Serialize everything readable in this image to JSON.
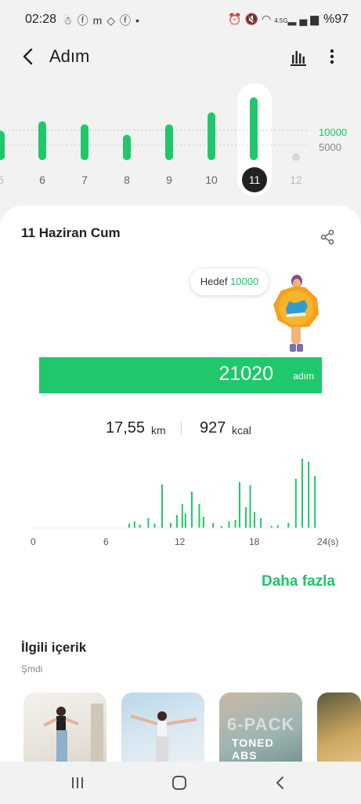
{
  "status_bar": {
    "time": "02:28",
    "left_icons": [
      "snapchat-icon",
      "facebook-icon",
      "m-icon",
      "tag-icon",
      "facebook-icon",
      "dot-icon"
    ],
    "right_icons": [
      "alarm-icon",
      "mute-icon",
      "wifi-icon",
      "4g-icon",
      "signal-icon"
    ],
    "network": "4.5G",
    "battery": "%97"
  },
  "header": {
    "title": "Adım",
    "chart_icon": "bar-chart-icon",
    "more_icon": "more-vert-icon",
    "back_icon": "back-chevron-icon"
  },
  "day_chart": {
    "goal_high": "10000",
    "goal_low": "5000",
    "labels": [
      "5",
      "6",
      "7",
      "8",
      "9",
      "10",
      "11",
      "12"
    ],
    "selected": "11",
    "accent": "#20c86b"
  },
  "chart_data": [
    {
      "type": "bar",
      "title": "",
      "categories": [
        "5",
        "6",
        "7",
        "8",
        "9",
        "10",
        "11",
        "12"
      ],
      "values": [
        9800,
        13000,
        12000,
        8500,
        12000,
        16000,
        21020,
        0
      ],
      "reference_lines": [
        10000,
        5000
      ],
      "xlabel": "",
      "ylabel": ""
    },
    {
      "type": "bar",
      "title": "",
      "x": [
        0,
        24
      ],
      "tick_labels": [
        "0",
        "6",
        "12",
        "18",
        "24(s)"
      ],
      "values": [
        0,
        0,
        0,
        0,
        0,
        0,
        0,
        0,
        0,
        0,
        0,
        0,
        0,
        0,
        0,
        0,
        0,
        0,
        0,
        0,
        0,
        0,
        0,
        0,
        0,
        0,
        0,
        0,
        0,
        0,
        0,
        0,
        0,
        0,
        0,
        0,
        0,
        0,
        0,
        0,
        0,
        0,
        0,
        0,
        0,
        0,
        0,
        0,
        0,
        0,
        0,
        0,
        0,
        0,
        0,
        0,
        0,
        0,
        0,
        0,
        0,
        0,
        0,
        0,
        0,
        0,
        0,
        0,
        0,
        0,
        0,
        0,
        0,
        0,
        0,
        0,
        0,
        0,
        0,
        0,
        0,
        0,
        0,
        0,
        0,
        0,
        0,
        0,
        0,
        0,
        0,
        0,
        0,
        0,
        0,
        0,
        0,
        0,
        0,
        0
      ],
      "xlabel": "",
      "ylabel": ""
    }
  ],
  "summary": {
    "date": "11 Haziran Cum",
    "share_icon": "share-icon",
    "goal_label": "Hedef",
    "goal_value": "10000",
    "steps": "21020",
    "steps_unit": "adım",
    "distance": "17,55",
    "distance_unit": "km",
    "calories": "927",
    "calories_unit": "kcal"
  },
  "hour_chart": {
    "ticks": [
      "0",
      "6",
      "12",
      "18",
      "24(s)"
    ]
  },
  "more_link": "Daha fazla",
  "related": {
    "title": "İlgili içerik",
    "subtitle": "Şmdi",
    "thumb3_big": "6-PACK",
    "thumb3_small": "TONED ABS"
  },
  "nav": {
    "recent_icon": "recent-apps-icon",
    "home_icon": "home-icon",
    "back_icon": "nav-back-icon"
  }
}
